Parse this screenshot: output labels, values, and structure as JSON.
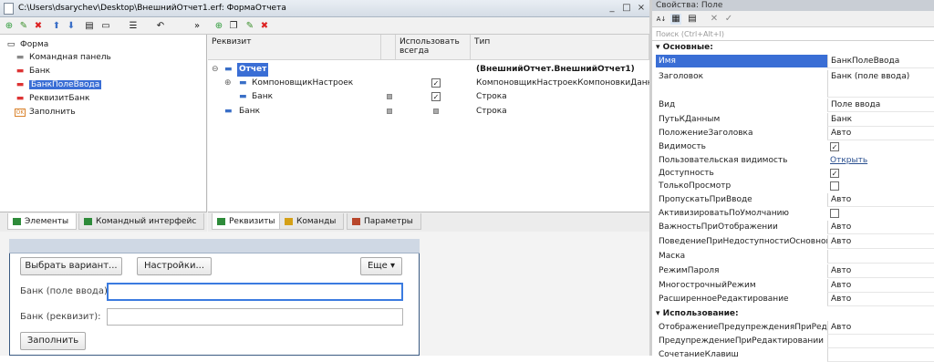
{
  "window": {
    "title": "C:\\Users\\dsarychev\\Desktop\\ВнешнийОтчет1.erf: ФормаОтчета",
    "controls": [
      "_",
      "□",
      "×"
    ]
  },
  "left_toolbar_icons": [
    "add-icon",
    "edit-icon",
    "delete-icon",
    "move-up-icon",
    "move-down-icon",
    "form-icon",
    "preview-icon",
    "list-icon",
    "undo-icon",
    "more-icon"
  ],
  "elements_tree": [
    {
      "label": "Форма",
      "icon": "form-icon",
      "level": 0
    },
    {
      "label": "Командная панель",
      "icon": "command-panel-icon",
      "level": 1
    },
    {
      "label": "Банк",
      "icon": "field-icon",
      "level": 1
    },
    {
      "label": "БанкПолеВвода",
      "icon": "field-icon",
      "level": 1,
      "selected": true
    },
    {
      "label": "РеквизитБанк",
      "icon": "field-icon",
      "level": 1
    },
    {
      "label": "Заполнить",
      "icon": "button-ok-icon",
      "level": 1
    }
  ],
  "left_tabs": [
    {
      "label": "Элементы",
      "active": true,
      "color": "#2e8b3a"
    },
    {
      "label": "Командный интерфейс",
      "active": false,
      "color": "#2e8b3a"
    }
  ],
  "grid": {
    "headers": {
      "attribute": "Реквизит",
      "use_always": "Использовать всегда",
      "type": "Тип"
    },
    "rows": [
      {
        "name": "Отчет",
        "type": "(ВнешнийОтчет.ВнешнийОтчет1)",
        "level": 0,
        "selected": true,
        "check": null
      },
      {
        "name": "КомпоновщикНастроек",
        "type": "КомпоновщикНастроекКомпоновкиДанных",
        "level": 1,
        "check": true
      },
      {
        "name": "Банк",
        "type": "Строка",
        "level": 1,
        "check": true
      },
      {
        "name": "Банк",
        "type": "Строка",
        "level": 0,
        "check": null
      }
    ]
  },
  "right_tabs": [
    {
      "label": "Реквизиты",
      "active": true,
      "color": "#2e8b3a"
    },
    {
      "label": "Команды",
      "active": false,
      "color": "#d4a017"
    },
    {
      "label": "Параметры",
      "active": false,
      "color": "#b8462b"
    }
  ],
  "form_preview": {
    "buttons": {
      "select_variant": "Выбрать вариант...",
      "settings": "Настройки...",
      "more": "Еще",
      "fill": "Заполнить"
    },
    "fields": {
      "bank_input_label": "Банк (поле ввода):",
      "bank_attr_label": "Банк (реквизит):"
    }
  },
  "properties": {
    "title": "Свойства: Поле",
    "search_placeholder": "Поиск (Ctrl+Alt+I)",
    "sections": [
      {
        "title": "Основные:",
        "rows": [
          {
            "name": "Имя",
            "value": "БанкПолеВвода",
            "kind": "text",
            "highlight": true
          },
          {
            "name": "Заголовок",
            "value": "Банк (поле ввода)",
            "kind": "text"
          },
          {
            "name": "Вид",
            "value": "Поле ввода",
            "kind": "text"
          },
          {
            "name": "ПутьКДанным",
            "value": "Банк",
            "kind": "text"
          },
          {
            "name": "ПоложениеЗаголовка",
            "value": "Авто",
            "kind": "text"
          },
          {
            "name": "Видимость",
            "value": "✓",
            "kind": "check"
          },
          {
            "name": "Пользовательская видимость",
            "value": "Открыть",
            "kind": "link"
          },
          {
            "name": "Доступность",
            "value": "✓",
            "kind": "check"
          },
          {
            "name": "ТолькоПросмотр",
            "value": "",
            "kind": "check"
          },
          {
            "name": "ПропускатьПриВводе",
            "value": "Авто",
            "kind": "text"
          },
          {
            "name": "АктивизироватьПоУмолчанию",
            "value": "",
            "kind": "check"
          },
          {
            "name": "ВажностьПриОтображении",
            "value": "Авто",
            "kind": "text"
          },
          {
            "name": "ПоведениеПриНедоступностиОсновногоСерв",
            "value": "Авто",
            "kind": "text"
          },
          {
            "name": "Маска",
            "value": "",
            "kind": "text"
          },
          {
            "name": "РежимПароля",
            "value": "Авто",
            "kind": "text"
          },
          {
            "name": "МногострочныйРежим",
            "value": "Авто",
            "kind": "text"
          },
          {
            "name": "РасширенноеРедактирование",
            "value": "Авто",
            "kind": "text"
          }
        ]
      },
      {
        "title": "Использование:",
        "rows": [
          {
            "name": "ОтображениеПредупрежденияПриРедактиров",
            "value": "Авто",
            "kind": "text"
          },
          {
            "name": "ПредупреждениеПриРедактировании",
            "value": "",
            "kind": "text"
          },
          {
            "name": "СочетаниеКлавиш",
            "value": "",
            "kind": "text"
          }
        ]
      }
    ]
  }
}
